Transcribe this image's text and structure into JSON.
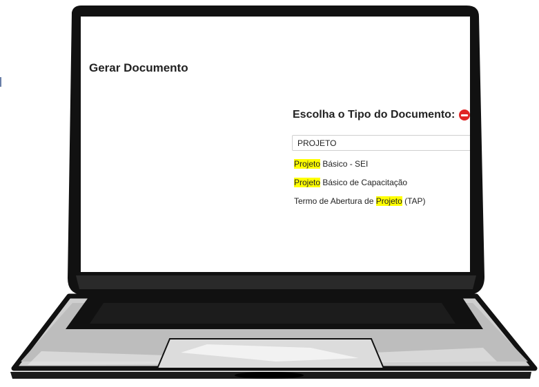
{
  "page": {
    "title": "Gerar Documento"
  },
  "document_type": {
    "label": "Escolha o Tipo do Documento:",
    "remove_icon": "minus-circle-icon",
    "remove_color": "#e02424",
    "input_value": "PROJETO",
    "highlight_color": "#ffff00",
    "suggestions": [
      {
        "before": "",
        "match": "Projeto",
        "after": " Básico - SEI"
      },
      {
        "before": "",
        "match": "Projeto",
        "after": " Básico de Capacitação"
      },
      {
        "before": "Termo de Abertura de ",
        "match": "Projeto",
        "after": " (TAP)"
      }
    ]
  },
  "device": {
    "frame": "laptop",
    "frame_color": "#111111",
    "body_color": "#c8c8c8"
  }
}
